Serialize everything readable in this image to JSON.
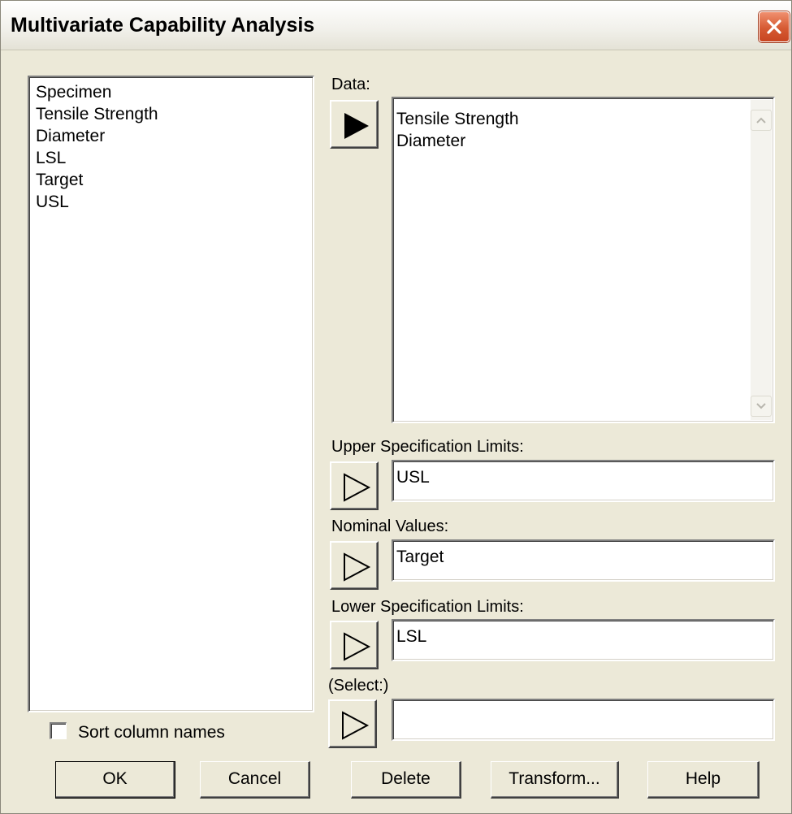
{
  "window": {
    "title": "Multivariate Capability Analysis"
  },
  "variable_list": {
    "items": [
      "Specimen",
      "Tensile Strength",
      "Diameter",
      "LSL",
      "Target",
      "USL"
    ]
  },
  "data_field": {
    "label": "Data:",
    "items": [
      "Tensile Strength",
      "Diameter"
    ]
  },
  "upper_spec": {
    "label": "Upper Specification Limits:",
    "value": "USL"
  },
  "nominal": {
    "label": "Nominal Values:",
    "value": "Target"
  },
  "lower_spec": {
    "label": "Lower Specification Limits:",
    "value": "LSL"
  },
  "select": {
    "label": "(Select:)",
    "value": ""
  },
  "sort_columns": {
    "label": "Sort column names",
    "checked": false
  },
  "buttons": {
    "ok": "OK",
    "cancel": "Cancel",
    "delete": "Delete",
    "transform": "Transform...",
    "help": "Help"
  },
  "icons": {
    "close": "close-icon",
    "arrow_filled": "arrow-right-filled-icon",
    "arrow_outline": "arrow-right-outline-icon",
    "scroll_up": "chevron-up-icon",
    "scroll_down": "chevron-down-icon"
  },
  "colors": {
    "dialog_bg": "#ece9d8",
    "close_button": "#d65a33"
  }
}
